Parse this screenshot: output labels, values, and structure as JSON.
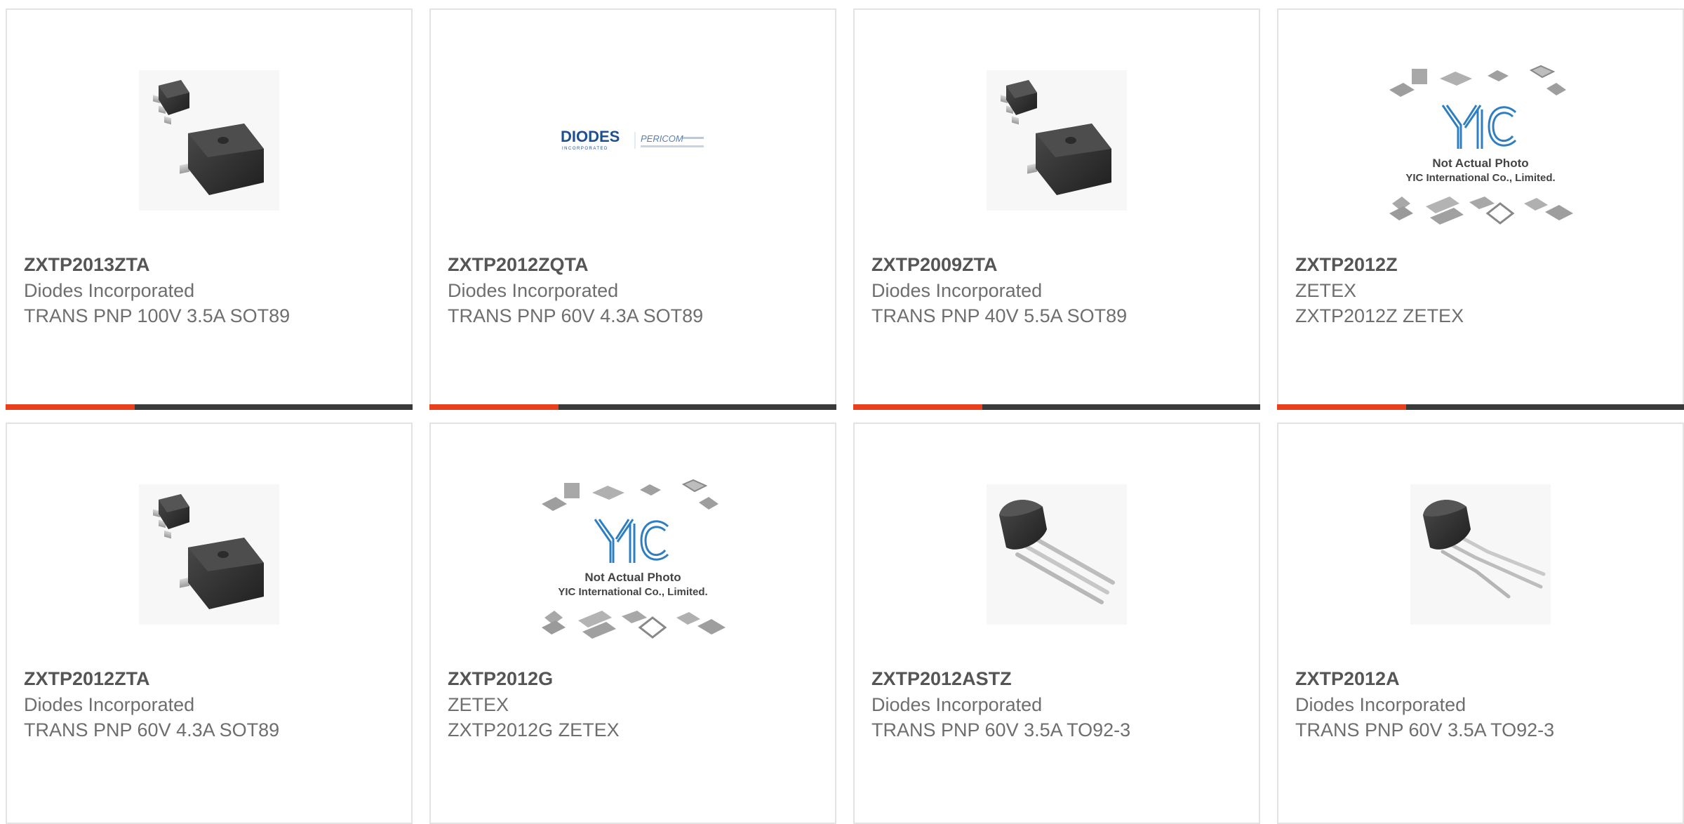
{
  "colors": {
    "accent": "#e8401c",
    "bar": "#3a3a3a",
    "border": "#e3e3e3",
    "title": "#555555",
    "text": "#6e6e6e"
  },
  "products": [
    {
      "part_number": "ZXTP2013ZTA",
      "manufacturer": "Diodes Incorporated",
      "description": "TRANS PNP 100V 3.5A SOT89",
      "image": "sot89-package-icon"
    },
    {
      "part_number": "ZXTP2012ZQTA",
      "manufacturer": "Diodes Incorporated",
      "description": "TRANS PNP 60V 4.3A SOT89",
      "image": "diodes-pericom-logo",
      "logo": {
        "brand": "DIODES",
        "tagline": "INCORPORATED",
        "sub_brand": "PERICOM"
      }
    },
    {
      "part_number": "ZXTP2009ZTA",
      "manufacturer": "Diodes Incorporated",
      "description": "TRANS PNP 40V 5.5A SOT89",
      "image": "sot89-package-icon"
    },
    {
      "part_number": "ZXTP2012Z",
      "manufacturer": "ZETEX",
      "description": "ZXTP2012Z ZETEX",
      "image": "yic-placeholder",
      "placeholder": {
        "logo": "YIC",
        "line1": "Not Actual Photo",
        "line2": "YIC International Co., Limited."
      }
    },
    {
      "part_number": "ZXTP2012ZTA",
      "manufacturer": "Diodes Incorporated",
      "description": "TRANS PNP 60V 4.3A SOT89",
      "image": "sot89-package-icon"
    },
    {
      "part_number": "ZXTP2012G",
      "manufacturer": "ZETEX",
      "description": "ZXTP2012G ZETEX",
      "image": "yic-placeholder",
      "placeholder": {
        "logo": "YIC",
        "line1": "Not Actual Photo",
        "line2": "YIC International Co., Limited."
      }
    },
    {
      "part_number": "ZXTP2012ASTZ",
      "manufacturer": "Diodes Incorporated",
      "description": "TRANS PNP 60V 3.5A TO92-3",
      "image": "to92-straight-leads-icon"
    },
    {
      "part_number": "ZXTP2012A",
      "manufacturer": "Diodes Incorporated",
      "description": "TRANS PNP 60V 3.5A TO92-3",
      "image": "to92-bent-leads-icon"
    }
  ]
}
